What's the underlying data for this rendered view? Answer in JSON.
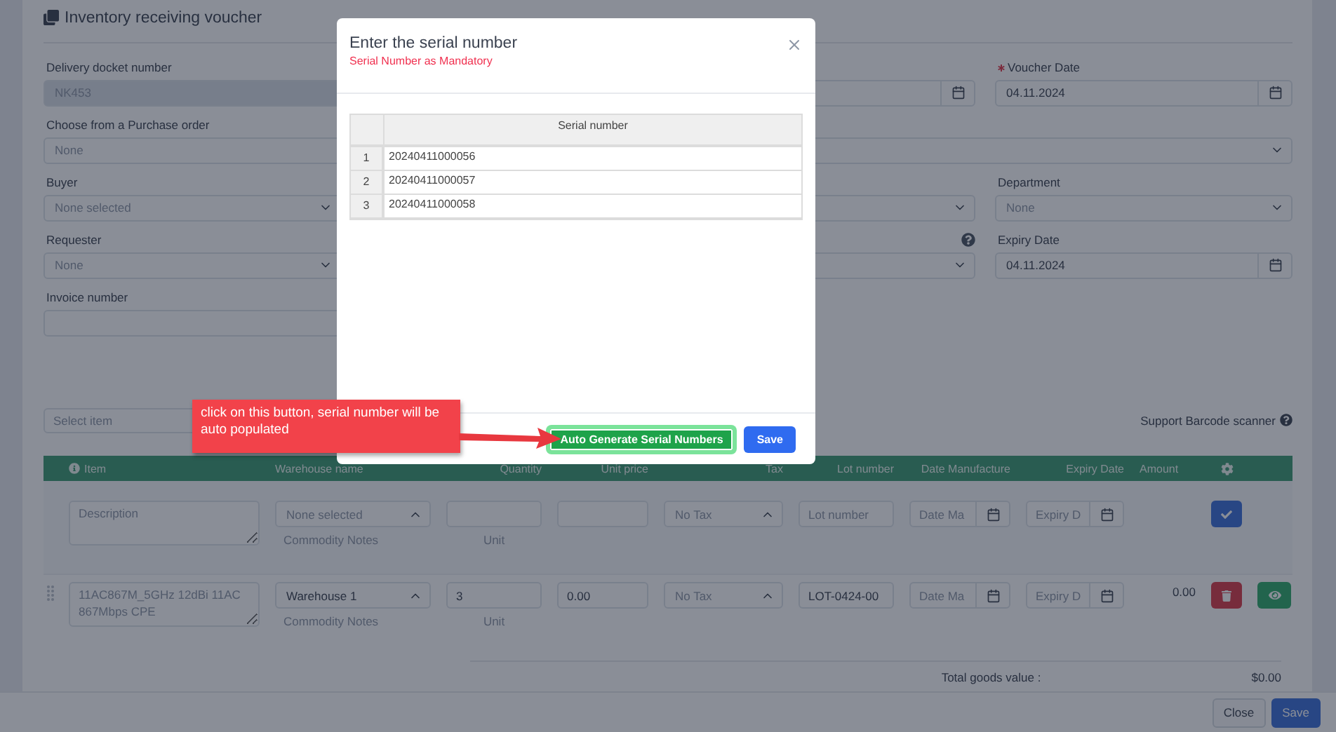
{
  "page": {
    "title": "Inventory receiving voucher",
    "form_rows": [
      {
        "fields": [
          {
            "label": "Delivery docket number",
            "kind": "text",
            "value": "NK453",
            "wide": true,
            "disabled": true,
            "required": false,
            "help": false
          },
          {
            "kind": "date",
            "wide": false,
            "disabled": false,
            "required": false,
            "help": false
          },
          {
            "label": "Voucher Date",
            "kind": "date",
            "value": "04.11.2024",
            "wide": false,
            "disabled": false,
            "required": true,
            "help": false
          }
        ]
      },
      {
        "fields": [
          {
            "label": "Choose from a Purchase order",
            "kind": "select",
            "value": "None",
            "wide": true,
            "disabled": false,
            "required": false,
            "help": false
          }
        ]
      },
      {
        "fields": [
          {
            "label": "Buyer",
            "kind": "select",
            "value": "None selected",
            "wide": false,
            "disabled": false,
            "required": false,
            "help": false
          },
          {
            "kind": "select",
            "wide": true,
            "disabled": false,
            "required": false,
            "help": false
          },
          {
            "label": "Department",
            "kind": "select",
            "value": "None",
            "wide": false,
            "disabled": false,
            "required": false,
            "help": false
          }
        ]
      },
      {
        "fields": [
          {
            "label": "Requester",
            "kind": "select",
            "value": "None",
            "wide": false,
            "disabled": false,
            "required": false,
            "help": false
          },
          {
            "kind": "select",
            "wide": true,
            "disabled": false,
            "required": false,
            "help": true
          },
          {
            "label": "Expiry Date",
            "kind": "date",
            "value": "04.11.2024",
            "wide": false,
            "disabled": false,
            "required": false,
            "help": false
          }
        ]
      },
      {
        "fields": [
          {
            "label": "Invoice number",
            "kind": "text",
            "wide": false,
            "disabled": false,
            "required": false,
            "help": false
          }
        ]
      }
    ],
    "items": {
      "search_placeholder": "Select item",
      "barcode_label": "Support Barcode scanner",
      "columns": [
        "Item",
        "Warehouse name",
        "Quantity",
        "Unit price",
        "Tax",
        "Lot number",
        "Date Manufacture",
        "Expiry Date",
        "Amount"
      ],
      "new_row": {
        "description_placeholder": "Description",
        "warehouse": "None selected",
        "notes": "Commodity Notes",
        "unit": "Unit",
        "tax": "No Tax",
        "lot_placeholder": "Lot number",
        "date_placeholder": "Date Ma",
        "expiry_placeholder": "Expiry D"
      },
      "rows": [
        {
          "description": "11AC867M_5GHz 12dBi 11AC 867Mbps CPE",
          "warehouse": "Warehouse 1",
          "notes": "Commodity Notes",
          "quantity": "3",
          "unit": "Unit",
          "price": "0.00",
          "tax": "No Tax",
          "lot": "LOT-0424-00",
          "date_placeholder": "Date Ma",
          "expiry_placeholder": "Expiry D",
          "amount": "0.00"
        }
      ],
      "total_label": "Total goods value :",
      "total": "$0.00"
    },
    "footer_buttons": [
      {
        "label": "Close",
        "kind": "secondary"
      },
      {
        "label": "Save",
        "kind": "primary"
      }
    ]
  },
  "dialog": {
    "title": "Enter the serial number",
    "subtitle": "Serial Number as Mandatory",
    "column": "Serial number",
    "rows": [
      {
        "index": "1",
        "serial": "20240411000056"
      },
      {
        "index": "2",
        "serial": "20240411000057"
      },
      {
        "index": "3",
        "serial": "20240411000058"
      }
    ],
    "buttons": [
      {
        "label": "Auto Generate Serial Numbers",
        "kind": "success",
        "focused": true
      },
      {
        "label": "Save",
        "kind": "primary",
        "focused": false
      }
    ]
  },
  "callout": {
    "text": "click on this button, serial number will be auto populated"
  }
}
